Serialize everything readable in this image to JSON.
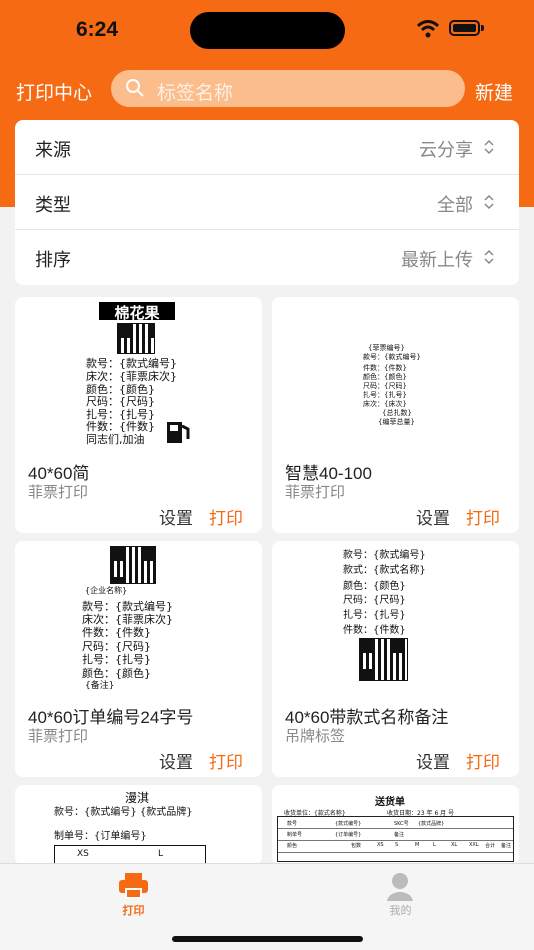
{
  "status": {
    "time": "6:24",
    "wifi_icon": "wifi-icon",
    "battery_icon": "battery-icon"
  },
  "header": {
    "title": "打印中心",
    "search_placeholder": "标签名称",
    "new_label": "新建",
    "accent": "#f56a12"
  },
  "filters": [
    {
      "label": "来源",
      "value": "云分享"
    },
    {
      "label": "类型",
      "value": "全部"
    },
    {
      "label": "排序",
      "value": "最新上传"
    }
  ],
  "actions": {
    "settings": "设置",
    "print": "打印"
  },
  "templates": [
    {
      "name": "40*60简",
      "type": "菲票打印",
      "preview": {
        "title": "棉花果",
        "lines": [
          "款号：{款式编号}",
          "床次：{菲票床次}",
          "颜色：{颜色}",
          "尺码：{尺码}",
          "扎号：{扎号}",
          "件数：{件数}",
          "同志们,加油"
        ]
      }
    },
    {
      "name": "智慧40-100",
      "type": "菲票打印",
      "preview": {
        "lines": [
          "{菲票编号}",
          "款号：{款式编号}",
          "件数：{件数}",
          "颜色：{颜色}",
          "尺码：{尺码}",
          "扎号：{扎号}",
          "床次：{床次}",
          "{总扎数}",
          "{编菲总量}"
        ]
      }
    },
    {
      "name": "40*60订单编号24字号",
      "type": "菲票打印",
      "preview": {
        "lines": [
          "{企业名称}",
          "款号：{款式编号}",
          "床次：{菲票床次}",
          "件数：{件数}",
          "尺码：{尺码}",
          "扎号：{扎号}",
          "颜色：{颜色}",
          "{备注}"
        ]
      }
    },
    {
      "name": "40*60带款式名称备注",
      "type": "吊牌标签",
      "preview": {
        "lines": [
          "款号：{款式编号}",
          "款式：{款式名称}",
          "颜色：{颜色}",
          "尺码：{尺码}",
          "扎号：{扎号}",
          "件数：{件数}"
        ]
      }
    },
    {
      "preview": {
        "title": "漫淇",
        "lines": [
          "款号：{款式编号}  {款式品牌}",
          "制单号：{订单编号}",
          "XS",
          "L"
        ]
      }
    },
    {
      "preview": {
        "title": "送货单",
        "lines": [
          "收货单位：{款式名称}",
          "收货日期：23 年 6 月 号",
          "款号",
          "{款式编号}",
          "SKC号",
          "{款式品牌}",
          "制单号",
          "{订单编号}",
          "备注",
          "颜色",
          "包数",
          "XS",
          "S",
          "M",
          "L",
          "XL",
          "XXL",
          "合计",
          "备注"
        ]
      }
    }
  ],
  "tabs": [
    {
      "label": "打印",
      "icon": "printer-icon"
    },
    {
      "label": "我的",
      "icon": "user-icon"
    }
  ]
}
